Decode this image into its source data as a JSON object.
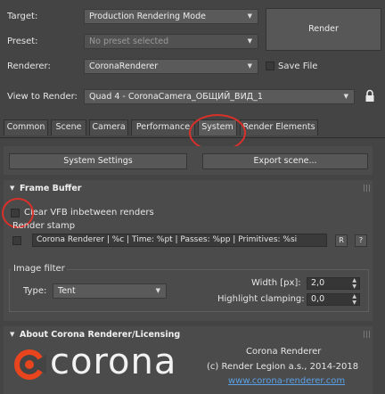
{
  "header": {
    "target_label": "Target:",
    "target_value": "Production Rendering Mode",
    "preset_label": "Preset:",
    "preset_placeholder": "No preset selected",
    "renderer_label": "Renderer:",
    "renderer_value": "CoronaRenderer",
    "save_file_label": "Save File",
    "view_label": "View to Render:",
    "view_value": "Quad 4 - CoronaCamera_ОБЩИЙ_ВИД_1",
    "render_button": "Render"
  },
  "tabs": [
    "Common",
    "Scene",
    "Camera",
    "Performance",
    "System",
    "Render Elements"
  ],
  "active_tab": "System",
  "system": {
    "settings_button": "System Settings",
    "export_button": "Export scene..."
  },
  "frame_buffer": {
    "title": "Frame Buffer",
    "clear_vfb_label": "Clear VFB inbetween renders",
    "render_stamp_label": "Render stamp",
    "stamp_value": "Corona Renderer | %c | Time: %pt | Passes: %pp | Primitives: %si",
    "stamp_r_button": "R",
    "stamp_help_button": "?",
    "image_filter_label": "Image filter",
    "type_label": "Type:",
    "type_value": "Tent",
    "width_label": "Width [px]:",
    "width_value": "2,0",
    "highlight_label": "Highlight clamping:",
    "highlight_value": "0,0"
  },
  "about": {
    "title": "About Corona Renderer/Licensing",
    "logo_text": "corona",
    "product_name": "Corona Renderer",
    "copyright": "(c) Render Legion a.s., 2014-2018",
    "website": "www.corona-renderer.com"
  },
  "colors": {
    "background": "#444444",
    "annotation_red": "#d8312a",
    "link_blue": "#5aa0e6",
    "logo_orange": "#e8451e"
  }
}
